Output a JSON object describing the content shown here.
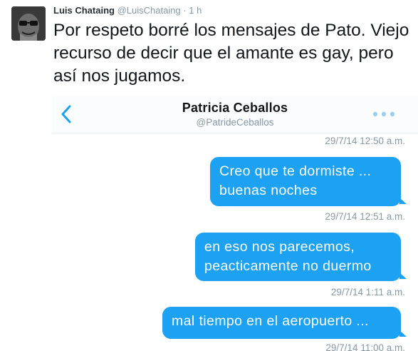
{
  "tweet": {
    "author_name": "Luis Chataing",
    "author_handle": "@LuisChataing",
    "separator": "·",
    "time": "1 h",
    "text": "Por respeto borré los mensajes de Pato. Viejo recurso de decir que el amante es gay, pero así nos jugamos."
  },
  "dm": {
    "contact_name": "Patricia Ceballos",
    "contact_handle": "@PatrideCeballos",
    "back_icon": "chevron-left-icon",
    "more_icon": "more-dots-icon",
    "accent_color": "#1da1f2",
    "messages": [
      {
        "timestamp": "29/7/14 12:50 a.m.",
        "text": ""
      },
      {
        "timestamp": "29/7/14 12:51 a.m.",
        "text": "Creo que te dormiste ... buenas noches"
      },
      {
        "timestamp": "29/7/14 1:11 a.m.",
        "text": "en eso nos parecemos, peacticamente no duermo"
      },
      {
        "timestamp": "29/7/14 11:00 a.m.",
        "text": "mal tiempo en el aeropuerto ..."
      }
    ]
  }
}
